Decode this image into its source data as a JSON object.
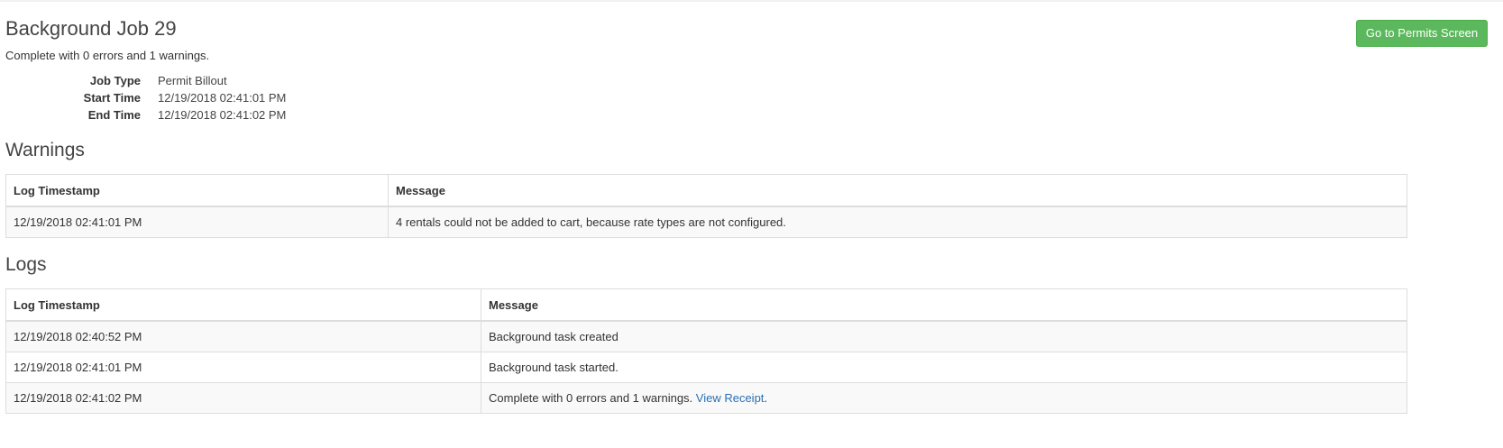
{
  "page": {
    "title": "Background Job 29",
    "subtitle": "Complete with 0 errors and 1 warnings.",
    "go_button_label": "Go to Permits Screen"
  },
  "details": [
    {
      "label": "Job Type",
      "value": "Permit Billout"
    },
    {
      "label": "Start Time",
      "value": "12/19/2018 02:41:01 PM"
    },
    {
      "label": "End Time",
      "value": "12/19/2018 02:41:02 PM"
    }
  ],
  "warnings": {
    "heading": "Warnings",
    "columns": [
      "Log Timestamp",
      "Message"
    ],
    "rows": [
      {
        "timestamp": "12/19/2018 02:41:01 PM",
        "message": "4 rentals could not be added to cart, because rate types are not configured."
      }
    ]
  },
  "logs": {
    "heading": "Logs",
    "columns": [
      "Log Timestamp",
      "Message"
    ],
    "rows": [
      {
        "timestamp": "12/19/2018 02:40:52 PM",
        "message": "Background task created"
      },
      {
        "timestamp": "12/19/2018 02:41:01 PM",
        "message": "Background task started."
      },
      {
        "timestamp": "12/19/2018 02:41:02 PM",
        "message": "Complete with 0 errors and 1 warnings. ",
        "link_text": "View Receipt",
        "after_link": "."
      }
    ]
  },
  "colors": {
    "primary_button": "#5cb85c",
    "link": "#2a6fb5",
    "stripe": "#f9f9f9",
    "border": "#dddddd"
  }
}
